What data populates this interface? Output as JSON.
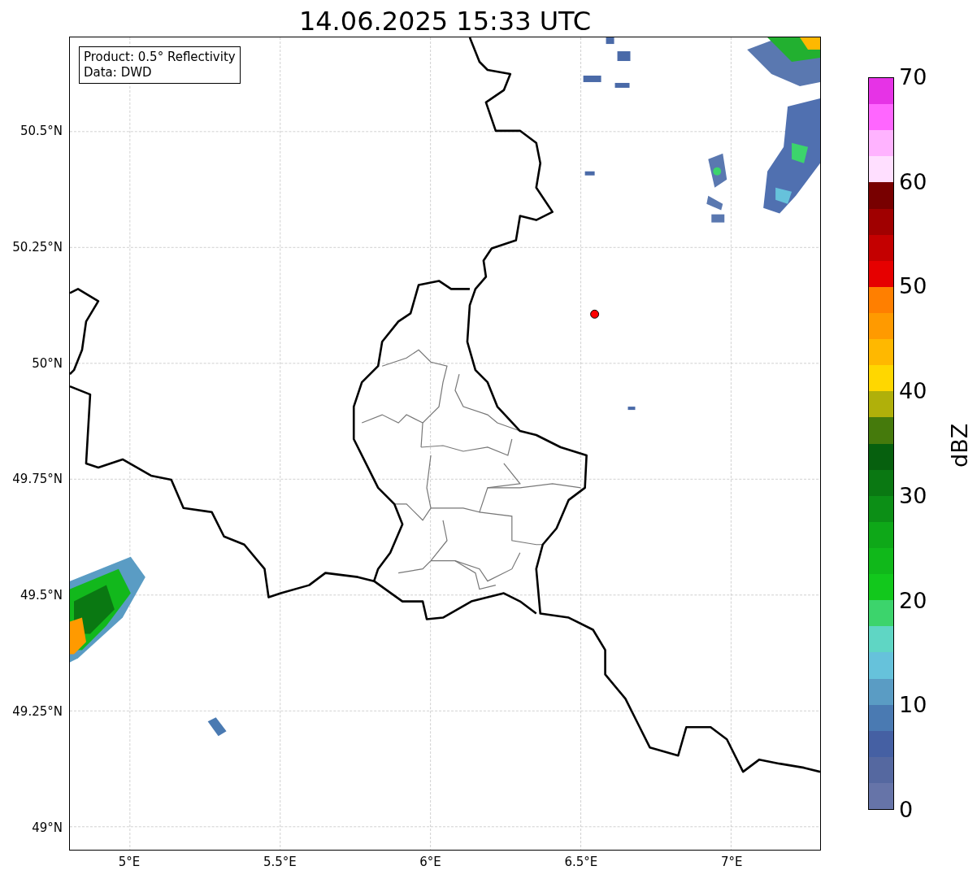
{
  "title": "14.06.2025 15:33 UTC",
  "info_box": [
    "Product: 0.5° Reflectivity",
    "Data: DWD"
  ],
  "lat_labels": [
    "50.5°N",
    "50.25°N",
    "50°N",
    "49.75°N",
    "49.5°N",
    "49.25°N",
    "49°N"
  ],
  "lon_labels": [
    "5°E",
    "5.5°E",
    "6°E",
    "6.5°E",
    "7°E"
  ],
  "colorbar": {
    "label": "dBZ",
    "ticks": [
      "70",
      "60",
      "50",
      "40",
      "30",
      "20",
      "10",
      "0"
    ],
    "segments": [
      {
        "color": "#e633e6"
      },
      {
        "color": "#ff66ff"
      },
      {
        "color": "#ffb3ff"
      },
      {
        "color": "#ffdfff"
      },
      {
        "color": "#780000"
      },
      {
        "color": "#a00000"
      },
      {
        "color": "#c40000"
      },
      {
        "color": "#e60000"
      },
      {
        "color": "#ff7f00"
      },
      {
        "color": "#ff9a00"
      },
      {
        "color": "#ffb800"
      },
      {
        "color": "#ffd700"
      },
      {
        "color": "#b0b00a"
      },
      {
        "color": "#457a0c"
      },
      {
        "color": "#06600e"
      },
      {
        "color": "#0a7812"
      },
      {
        "color": "#0c8f16"
      },
      {
        "color": "#0ea818"
      },
      {
        "color": "#10b81a"
      },
      {
        "color": "#12c81c"
      },
      {
        "color": "#3cd46c"
      },
      {
        "color": "#5fd6c4"
      },
      {
        "color": "#66c2db"
      },
      {
        "color": "#5a9cc4"
      },
      {
        "color": "#4a7ab2"
      },
      {
        "color": "#4560a3"
      },
      {
        "color": "#5568a0"
      },
      {
        "color": "#6674a8"
      }
    ]
  }
}
